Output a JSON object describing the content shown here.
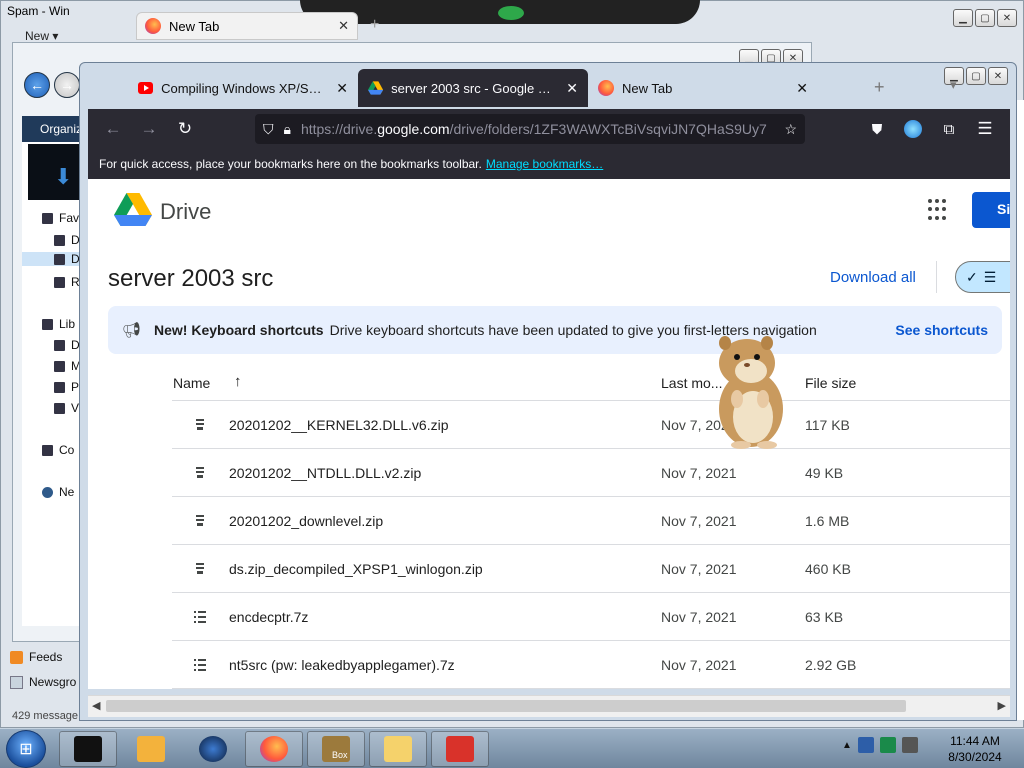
{
  "background_windows": {
    "mail_title": "Spam - Win",
    "new_menu": "New",
    "bg_tab_label": "New Tab",
    "explorer_organize": "Organiz",
    "explorer_items": [
      "Fav",
      "D",
      "D",
      "R",
      "Lib",
      "D",
      "M",
      "P",
      "V",
      "Co",
      "Ne"
    ],
    "feeds_label": "Feeds",
    "newsgroups_label": "Newsgro",
    "message_count": "429 message"
  },
  "browser": {
    "tabs": [
      {
        "label": "Compiling Windows XP/Server",
        "icon": "youtube-icon",
        "active": false
      },
      {
        "label": "server 2003 src - Google Drive",
        "icon": "google-drive-icon",
        "active": true
      },
      {
        "label": "New Tab",
        "icon": "firefox-icon",
        "active": false
      }
    ],
    "url_prefix": "https://drive.",
    "url_host": "google.com",
    "url_suffix": "/drive/folders/1ZF3WAWXTcBiVsqviJN7QHaS9Uy7",
    "bookmarks_text": "For quick access, place your bookmarks here on the bookmarks toolbar.",
    "bookmarks_link": "Manage bookmarks…"
  },
  "drive": {
    "app_name": "Drive",
    "signin_label": "Si",
    "folder_title": "server 2003 src",
    "download_all": "Download all",
    "banner": {
      "title": "New! Keyboard shortcuts",
      "text": "Drive keyboard shortcuts have been updated to give you first-letters navigation",
      "action": "See shortcuts"
    },
    "columns": {
      "name": "Name",
      "modified": "Last mo...",
      "size": "File size"
    },
    "files": [
      {
        "name": "20201202__KERNEL32.DLL.v6.zip",
        "modified": "Nov 7, 2021",
        "size": "117 KB",
        "icon": "zip-icon"
      },
      {
        "name": "20201202__NTDLL.DLL.v2.zip",
        "modified": "Nov 7, 2021",
        "size": "49 KB",
        "icon": "zip-icon"
      },
      {
        "name": "20201202_downlevel.zip",
        "modified": "Nov 7, 2021",
        "size": "1.6 MB",
        "icon": "zip-icon"
      },
      {
        "name": "ds.zip_decompiled_XPSP1_winlogon.zip",
        "modified": "Nov 7, 2021",
        "size": "460 KB",
        "icon": "zip-icon"
      },
      {
        "name": "encdecptr.7z",
        "modified": "Nov 7, 2021",
        "size": "63 KB",
        "icon": "archive-icon"
      },
      {
        "name": "nt5src (pw: leakedbyapplegamer).7z",
        "modified": "Nov 7, 2021",
        "size": "2.92 GB",
        "icon": "archive-icon"
      }
    ]
  },
  "taskbar": {
    "time": "11:44 AM",
    "date": "8/30/2024",
    "box_label": "Box"
  },
  "colors": {
    "drive_blue": "#0b57d0",
    "banner_bg": "#e8f0fe",
    "firefox_dark": "#2b2a33"
  }
}
